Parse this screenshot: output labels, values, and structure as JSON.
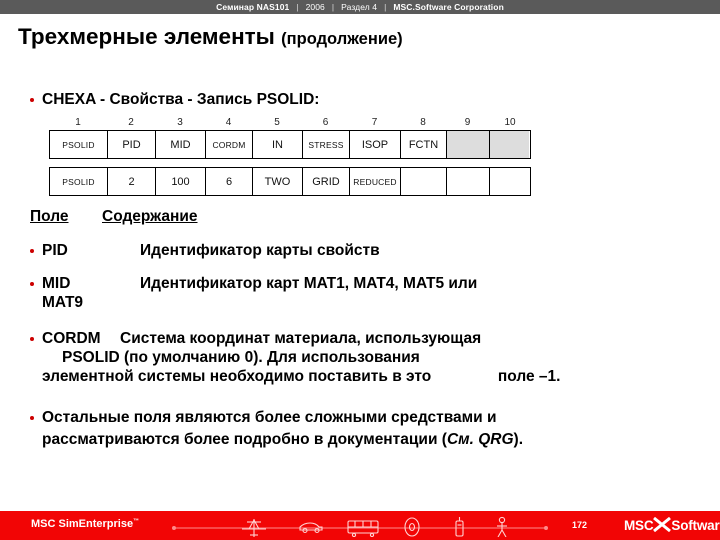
{
  "header": {
    "seminar": "Семинар NAS101",
    "year": "2006",
    "section": "Раздел 4",
    "company": "MSC.Software Corporation",
    "separator": "|"
  },
  "title": {
    "main": "Трехмерные элементы",
    "suffix": "(продолжение)"
  },
  "bullets": {
    "chexa": "CHEXA  - Свойства - Запись PSOLID:"
  },
  "card": {
    "column_numbers": [
      "1",
      "2",
      "3",
      "4",
      "5",
      "6",
      "7",
      "8",
      "9",
      "10"
    ],
    "header_row": [
      "PSOLID",
      "PID",
      "MID",
      "CORDM",
      "IN",
      "STRESS",
      "ISOP",
      "FCTN",
      "",
      ""
    ],
    "value_row": [
      "PSOLID",
      "2",
      "100",
      "6",
      "TWO",
      "GRID",
      "REDUCED",
      "",
      "",
      ""
    ],
    "shaded_header_cells": [
      8,
      9
    ]
  },
  "field_table": {
    "head_field": "Поле",
    "head_contents": "Содержание",
    "rows": [
      {
        "term": "PID",
        "text": "Идентификатор карты свойств"
      },
      {
        "term": "MID",
        "text": "Идентификатор карт MAT1, MAT4, MAT5 или",
        "text2": "MAT9"
      },
      {
        "term": "CORDM",
        "text": "Система координат материала, использующая",
        "text2": "PSOLID (по умолчанию 0). Для использования",
        "text3": "элементной системы необходимо поставить в это",
        "text4": "поле –1."
      }
    ],
    "last_bullet": {
      "line1": "Остальные поля являются более сложными средствами и",
      "line2": "рассматриваются более подробно в документации (",
      "ref": "См. QRG",
      "line3": ")."
    }
  },
  "footer": {
    "brand": "MSC SimEnterprise",
    "brand_tm": "™",
    "page": "172",
    "logo_left": "MSC",
    "logo_right": "Software",
    "logo_tm": "®"
  },
  "colors": {
    "header_bar": "#5a5a5a",
    "footer_red": "#f20505",
    "bullet_red": "#cc0000",
    "shaded_cell": "#dddddd"
  }
}
